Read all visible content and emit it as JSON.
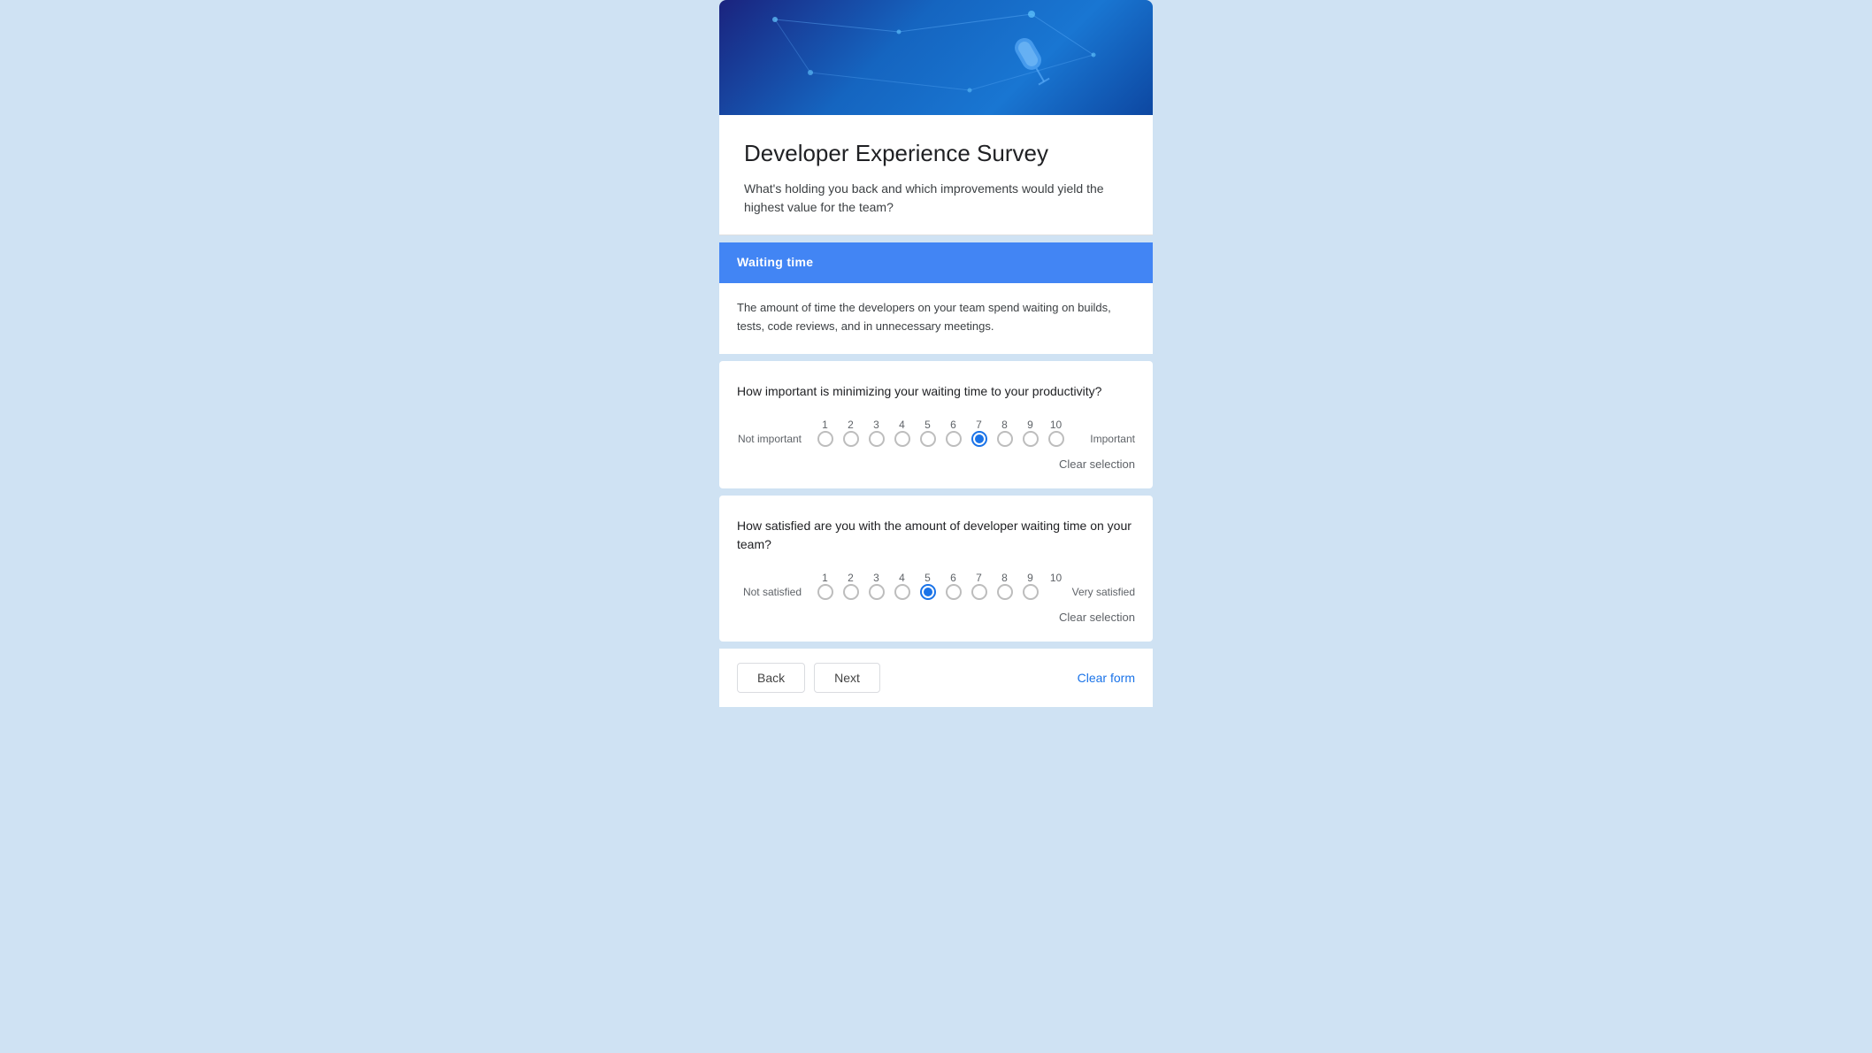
{
  "page": {
    "background_color": "#cfe2f3"
  },
  "survey": {
    "title": "Developer Experience Survey",
    "subtitle": "What's holding you back and which improvements would yield the highest value for the team?",
    "topic": {
      "header": "Waiting time",
      "description": "The amount of time the developers on your team spend waiting on builds, tests, code reviews, and in unnecessary meetings."
    },
    "questions": [
      {
        "id": "q1",
        "text": "How important is minimizing your waiting time to your productivity?",
        "scale_min_label": "Not important",
        "scale_max_label": "Important",
        "scale_min": 1,
        "scale_max": 10,
        "selected_value": 7,
        "clear_label": "Clear selection"
      },
      {
        "id": "q2",
        "text": "How satisfied are you with the amount of developer waiting time on your team?",
        "scale_min_label": "Not satisfied",
        "scale_max_label": "Very satisfied",
        "scale_min": 1,
        "scale_max": 10,
        "selected_value": 5,
        "clear_label": "Clear selection"
      }
    ],
    "navigation": {
      "back_label": "Back",
      "next_label": "Next",
      "clear_form_label": "Clear form"
    }
  }
}
